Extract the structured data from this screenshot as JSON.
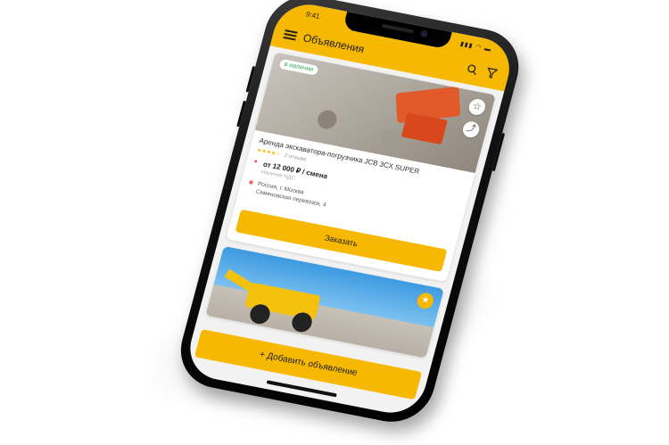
{
  "status": {
    "time": "9:41",
    "indicators": "▮▮▮ ◠ ▬"
  },
  "appbar": {
    "title": "Объявления",
    "menu_icon": "menu-icon",
    "search_icon": "search-icon",
    "filter_icon": "filter-icon"
  },
  "listings": [
    {
      "badge": "в наличии",
      "title": "Аренда экскаватора-погрузчика JCB 3CX SUPER",
      "rating": "★★★★☆",
      "reviews": "2 отзыва",
      "price": "от 12 000 ₽ / смена",
      "price_note": "Наличие НДС",
      "address_line1": "Россия, г. Москва",
      "address_line2": "Семеновская перевозок, 4",
      "order_label": "Заказать"
    },
    {
      "badge": "",
      "title": "",
      "favorite": true
    }
  ],
  "add_button": "+ Добавить объявление",
  "colors": {
    "accent": "#f6b800",
    "in_stock": "#2fa84f"
  }
}
